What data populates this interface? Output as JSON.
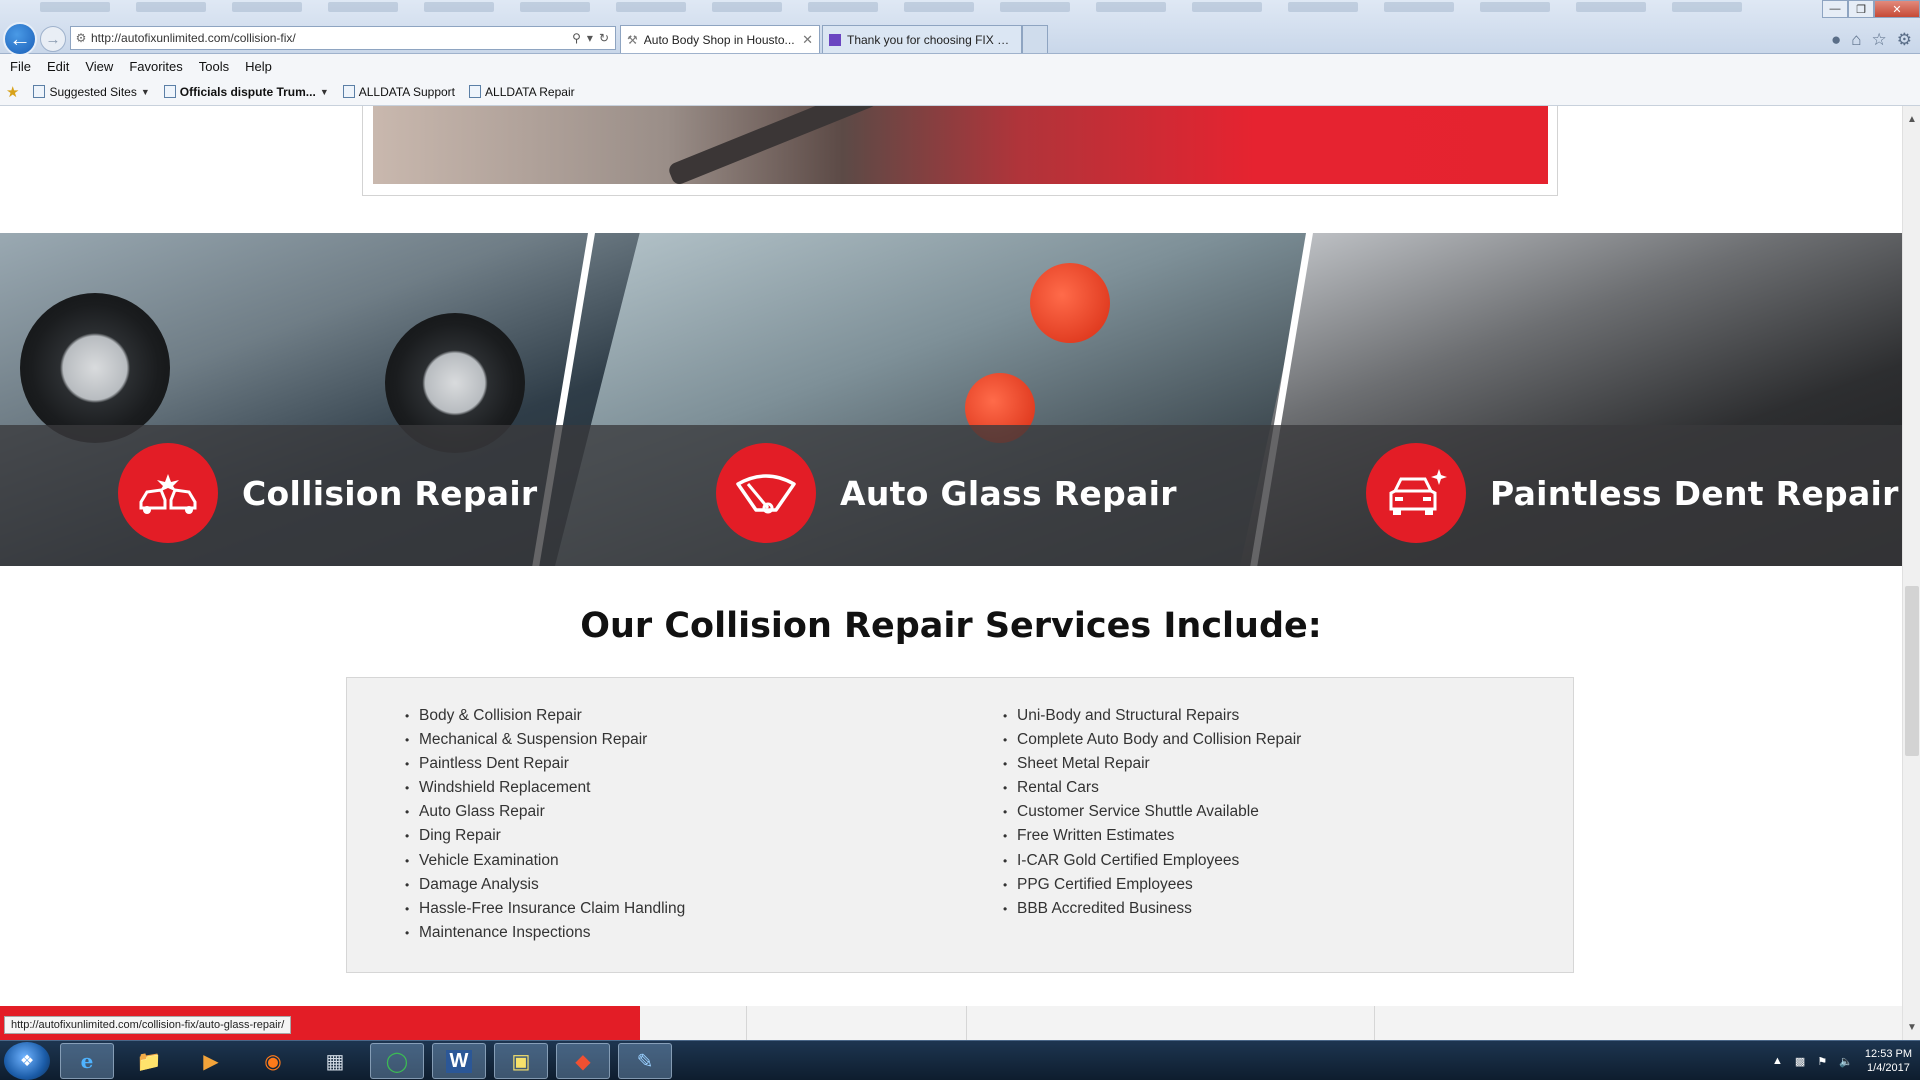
{
  "browser": {
    "url": "http://autofixunlimited.com/collision-fix/",
    "tabs": [
      {
        "label": "Auto Body Shop in Housto..."
      },
      {
        "label": "Thank you for choosing FIX Un..."
      }
    ],
    "menu": [
      "File",
      "Edit",
      "View",
      "Favorites",
      "Tools",
      "Help"
    ],
    "favorites": [
      {
        "label": "Suggested Sites"
      },
      {
        "label": "Officials dispute Trum..."
      },
      {
        "label": "ALLDATA Support"
      },
      {
        "label": "ALLDATA Repair"
      }
    ],
    "status_url": "http://autofixunlimited.com/collision-fix/auto-glass-repair/"
  },
  "page": {
    "services": [
      {
        "label": "Collision Repair",
        "icon": "collision-car-icon"
      },
      {
        "label": "Auto Glass Repair",
        "icon": "windshield-wiper-icon"
      },
      {
        "label": "Paintless Dent Repair",
        "icon": "car-sparkle-icon"
      }
    ],
    "section_title": "Our Collision Repair Services Include:",
    "list_left": [
      "Body & Collision Repair",
      "Mechanical & Suspension Repair",
      "Paintless Dent Repair",
      "Windshield Replacement",
      "Auto Glass Repair",
      "Ding Repair",
      "Vehicle Examination",
      "Damage Analysis",
      "Hassle-Free Insurance Claim Handling",
      "Maintenance Inspections"
    ],
    "list_right": [
      "Uni-Body and Structural Repairs",
      "Complete Auto Body and Collision Repair",
      "Sheet Metal Repair",
      "Rental Cars",
      "Customer Service Shuttle Available",
      "Free Written Estimates",
      "I-CAR Gold Certified Employees",
      "PPG Certified Employees",
      "BBB Accredited Business"
    ],
    "accent_color": "#e31d26"
  },
  "taskbar": {
    "time": "12:53 PM",
    "date": "1/4/2017",
    "apps": [
      "internet-explorer-icon",
      "file-explorer-icon",
      "media-player-icon",
      "firefox-icon",
      "calculator-icon",
      "chrome-icon",
      "word-icon",
      "sticky-notes-icon",
      "git-icon",
      "paint-icon"
    ]
  }
}
